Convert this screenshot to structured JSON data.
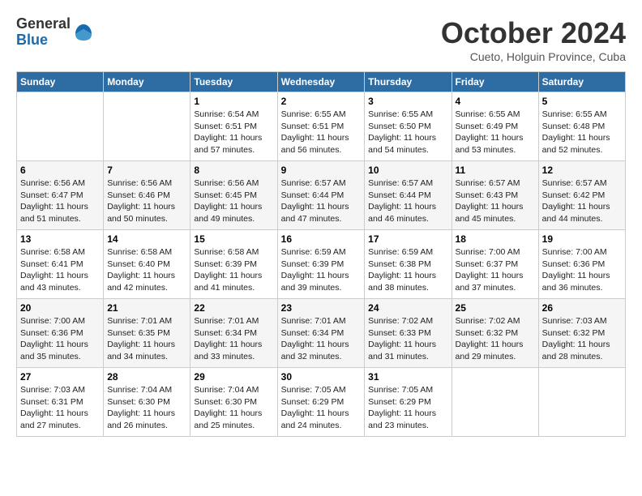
{
  "logo": {
    "general": "General",
    "blue": "Blue"
  },
  "title": "October 2024",
  "location": "Cueto, Holguin Province, Cuba",
  "days_header": [
    "Sunday",
    "Monday",
    "Tuesday",
    "Wednesday",
    "Thursday",
    "Friday",
    "Saturday"
  ],
  "weeks": [
    [
      {
        "day": "",
        "sunrise": "",
        "sunset": "",
        "daylight": ""
      },
      {
        "day": "",
        "sunrise": "",
        "sunset": "",
        "daylight": ""
      },
      {
        "day": "1",
        "sunrise": "Sunrise: 6:54 AM",
        "sunset": "Sunset: 6:51 PM",
        "daylight": "Daylight: 11 hours and 57 minutes."
      },
      {
        "day": "2",
        "sunrise": "Sunrise: 6:55 AM",
        "sunset": "Sunset: 6:51 PM",
        "daylight": "Daylight: 11 hours and 56 minutes."
      },
      {
        "day": "3",
        "sunrise": "Sunrise: 6:55 AM",
        "sunset": "Sunset: 6:50 PM",
        "daylight": "Daylight: 11 hours and 54 minutes."
      },
      {
        "day": "4",
        "sunrise": "Sunrise: 6:55 AM",
        "sunset": "Sunset: 6:49 PM",
        "daylight": "Daylight: 11 hours and 53 minutes."
      },
      {
        "day": "5",
        "sunrise": "Sunrise: 6:55 AM",
        "sunset": "Sunset: 6:48 PM",
        "daylight": "Daylight: 11 hours and 52 minutes."
      }
    ],
    [
      {
        "day": "6",
        "sunrise": "Sunrise: 6:56 AM",
        "sunset": "Sunset: 6:47 PM",
        "daylight": "Daylight: 11 hours and 51 minutes."
      },
      {
        "day": "7",
        "sunrise": "Sunrise: 6:56 AM",
        "sunset": "Sunset: 6:46 PM",
        "daylight": "Daylight: 11 hours and 50 minutes."
      },
      {
        "day": "8",
        "sunrise": "Sunrise: 6:56 AM",
        "sunset": "Sunset: 6:45 PM",
        "daylight": "Daylight: 11 hours and 49 minutes."
      },
      {
        "day": "9",
        "sunrise": "Sunrise: 6:57 AM",
        "sunset": "Sunset: 6:44 PM",
        "daylight": "Daylight: 11 hours and 47 minutes."
      },
      {
        "day": "10",
        "sunrise": "Sunrise: 6:57 AM",
        "sunset": "Sunset: 6:44 PM",
        "daylight": "Daylight: 11 hours and 46 minutes."
      },
      {
        "day": "11",
        "sunrise": "Sunrise: 6:57 AM",
        "sunset": "Sunset: 6:43 PM",
        "daylight": "Daylight: 11 hours and 45 minutes."
      },
      {
        "day": "12",
        "sunrise": "Sunrise: 6:57 AM",
        "sunset": "Sunset: 6:42 PM",
        "daylight": "Daylight: 11 hours and 44 minutes."
      }
    ],
    [
      {
        "day": "13",
        "sunrise": "Sunrise: 6:58 AM",
        "sunset": "Sunset: 6:41 PM",
        "daylight": "Daylight: 11 hours and 43 minutes."
      },
      {
        "day": "14",
        "sunrise": "Sunrise: 6:58 AM",
        "sunset": "Sunset: 6:40 PM",
        "daylight": "Daylight: 11 hours and 42 minutes."
      },
      {
        "day": "15",
        "sunrise": "Sunrise: 6:58 AM",
        "sunset": "Sunset: 6:39 PM",
        "daylight": "Daylight: 11 hours and 41 minutes."
      },
      {
        "day": "16",
        "sunrise": "Sunrise: 6:59 AM",
        "sunset": "Sunset: 6:39 PM",
        "daylight": "Daylight: 11 hours and 39 minutes."
      },
      {
        "day": "17",
        "sunrise": "Sunrise: 6:59 AM",
        "sunset": "Sunset: 6:38 PM",
        "daylight": "Daylight: 11 hours and 38 minutes."
      },
      {
        "day": "18",
        "sunrise": "Sunrise: 7:00 AM",
        "sunset": "Sunset: 6:37 PM",
        "daylight": "Daylight: 11 hours and 37 minutes."
      },
      {
        "day": "19",
        "sunrise": "Sunrise: 7:00 AM",
        "sunset": "Sunset: 6:36 PM",
        "daylight": "Daylight: 11 hours and 36 minutes."
      }
    ],
    [
      {
        "day": "20",
        "sunrise": "Sunrise: 7:00 AM",
        "sunset": "Sunset: 6:36 PM",
        "daylight": "Daylight: 11 hours and 35 minutes."
      },
      {
        "day": "21",
        "sunrise": "Sunrise: 7:01 AM",
        "sunset": "Sunset: 6:35 PM",
        "daylight": "Daylight: 11 hours and 34 minutes."
      },
      {
        "day": "22",
        "sunrise": "Sunrise: 7:01 AM",
        "sunset": "Sunset: 6:34 PM",
        "daylight": "Daylight: 11 hours and 33 minutes."
      },
      {
        "day": "23",
        "sunrise": "Sunrise: 7:01 AM",
        "sunset": "Sunset: 6:34 PM",
        "daylight": "Daylight: 11 hours and 32 minutes."
      },
      {
        "day": "24",
        "sunrise": "Sunrise: 7:02 AM",
        "sunset": "Sunset: 6:33 PM",
        "daylight": "Daylight: 11 hours and 31 minutes."
      },
      {
        "day": "25",
        "sunrise": "Sunrise: 7:02 AM",
        "sunset": "Sunset: 6:32 PM",
        "daylight": "Daylight: 11 hours and 29 minutes."
      },
      {
        "day": "26",
        "sunrise": "Sunrise: 7:03 AM",
        "sunset": "Sunset: 6:32 PM",
        "daylight": "Daylight: 11 hours and 28 minutes."
      }
    ],
    [
      {
        "day": "27",
        "sunrise": "Sunrise: 7:03 AM",
        "sunset": "Sunset: 6:31 PM",
        "daylight": "Daylight: 11 hours and 27 minutes."
      },
      {
        "day": "28",
        "sunrise": "Sunrise: 7:04 AM",
        "sunset": "Sunset: 6:30 PM",
        "daylight": "Daylight: 11 hours and 26 minutes."
      },
      {
        "day": "29",
        "sunrise": "Sunrise: 7:04 AM",
        "sunset": "Sunset: 6:30 PM",
        "daylight": "Daylight: 11 hours and 25 minutes."
      },
      {
        "day": "30",
        "sunrise": "Sunrise: 7:05 AM",
        "sunset": "Sunset: 6:29 PM",
        "daylight": "Daylight: 11 hours and 24 minutes."
      },
      {
        "day": "31",
        "sunrise": "Sunrise: 7:05 AM",
        "sunset": "Sunset: 6:29 PM",
        "daylight": "Daylight: 11 hours and 23 minutes."
      },
      {
        "day": "",
        "sunrise": "",
        "sunset": "",
        "daylight": ""
      },
      {
        "day": "",
        "sunrise": "",
        "sunset": "",
        "daylight": ""
      }
    ]
  ]
}
